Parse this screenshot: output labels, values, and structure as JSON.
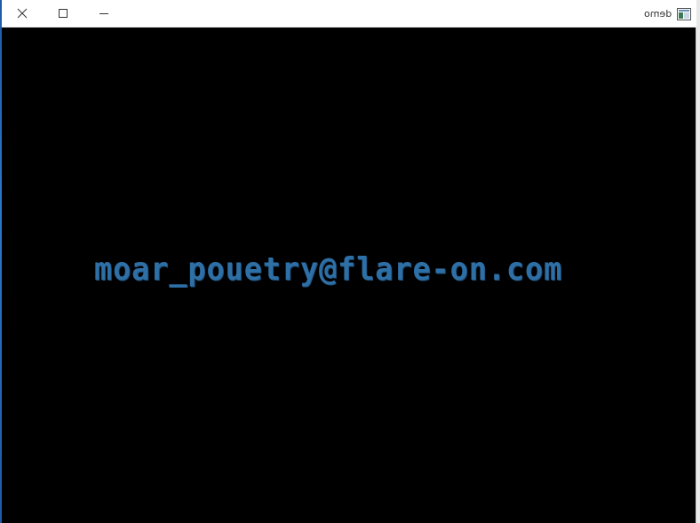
{
  "window": {
    "title": "demo",
    "icon": "app-window-icon",
    "buttons": {
      "close_icon": "close-icon",
      "maximize_icon": "maximize-icon",
      "minimize_icon": "minimize-icon"
    }
  },
  "client": {
    "background": "#000000",
    "text": "moar_pouetry@flare-on.com",
    "text_color": "#2e6fa6"
  }
}
